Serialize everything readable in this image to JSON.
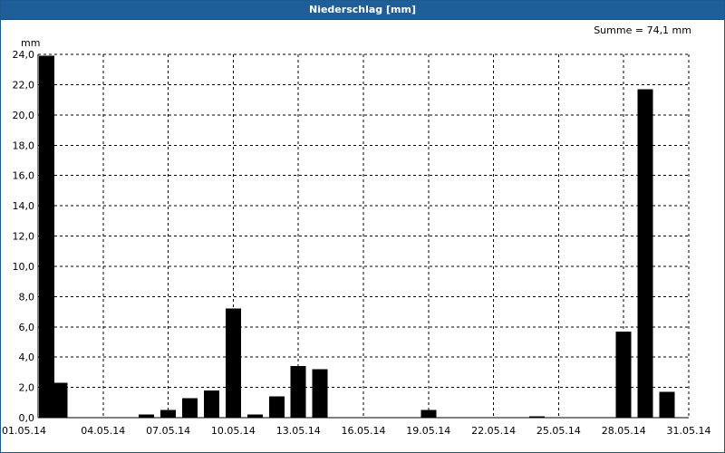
{
  "window": {
    "title": "Niederschlag [mm]"
  },
  "colors": {
    "titlebar": "#1e5f99",
    "bar": "#000000",
    "grid": "#000000"
  },
  "chart_data": {
    "type": "bar",
    "title": "Niederschlag [mm]",
    "ylabel": "mm",
    "summary": "Summe = 74,1 mm",
    "ylim": [
      0,
      24
    ],
    "grid": true,
    "x_start_day": 1,
    "x_end_day": 31,
    "xticks": [
      "01.05.14",
      "04.05.14",
      "07.05.14",
      "10.05.14",
      "13.05.14",
      "16.05.14",
      "19.05.14",
      "22.05.14",
      "25.05.14",
      "28.05.14",
      "31.05.14"
    ],
    "yticks": [
      "0,0",
      "2,0",
      "4,0",
      "6,0",
      "8,0",
      "10,0",
      "12,0",
      "14,0",
      "16,0",
      "18,0",
      "20,0",
      "22,0",
      "24,0"
    ],
    "categories": [
      "01.05.14",
      "02.05.14",
      "03.05.14",
      "04.05.14",
      "05.05.14",
      "06.05.14",
      "07.05.14",
      "08.05.14",
      "09.05.14",
      "10.05.14",
      "11.05.14",
      "12.05.14",
      "13.05.14",
      "14.05.14",
      "15.05.14",
      "16.05.14",
      "17.05.14",
      "18.05.14",
      "19.05.14",
      "20.05.14",
      "21.05.14",
      "22.05.14",
      "23.05.14",
      "24.05.14",
      "25.05.14",
      "26.05.14",
      "27.05.14",
      "28.05.14",
      "29.05.14",
      "30.05.14",
      "31.05.14"
    ],
    "values": [
      23.9,
      2.3,
      0,
      0,
      0,
      0.2,
      0.5,
      1.3,
      1.8,
      7.2,
      0.2,
      1.4,
      3.4,
      3.2,
      0,
      0,
      0,
      0,
      0.5,
      0,
      0,
      0,
      0,
      0.1,
      0,
      0,
      0,
      5.7,
      21.7,
      1.7,
      0
    ]
  }
}
